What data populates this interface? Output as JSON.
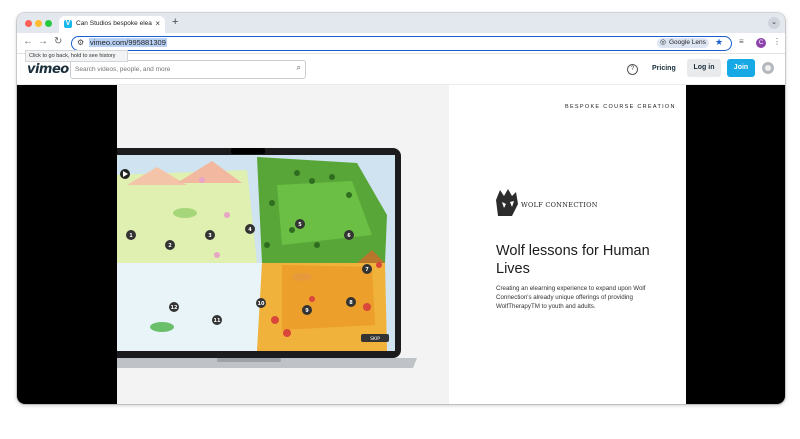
{
  "browser": {
    "tab_title": "Can Studios bespoke elearni",
    "tab_close": "×",
    "new_tab": "+",
    "url": "vimeo.com/995881309",
    "lens_label": "Google Lens",
    "profile_initial": "C",
    "tooltip": "Click to go back, hold to see history"
  },
  "vimeo": {
    "logo": "vimeo",
    "search_placeholder": "Search videos, people, and more",
    "pricing": "Pricing",
    "login": "Log in",
    "join": "Join",
    "accent_color": "#17a8e6"
  },
  "content": {
    "kicker": "BESPOKE COURSE CREATION",
    "brand": "WOLF CONNECTION",
    "headline": "Wolf lessons for Human Lives",
    "body": "Creating an elearning experience to expand upon Wolf Connection's already unique offerings of providing WolfTherapyTM to youth and adults."
  },
  "map": {
    "markers": [
      "1",
      "2",
      "3",
      "4",
      "5",
      "6",
      "7",
      "8",
      "9",
      "10",
      "11",
      "12"
    ],
    "skip_label": "SKIP"
  }
}
